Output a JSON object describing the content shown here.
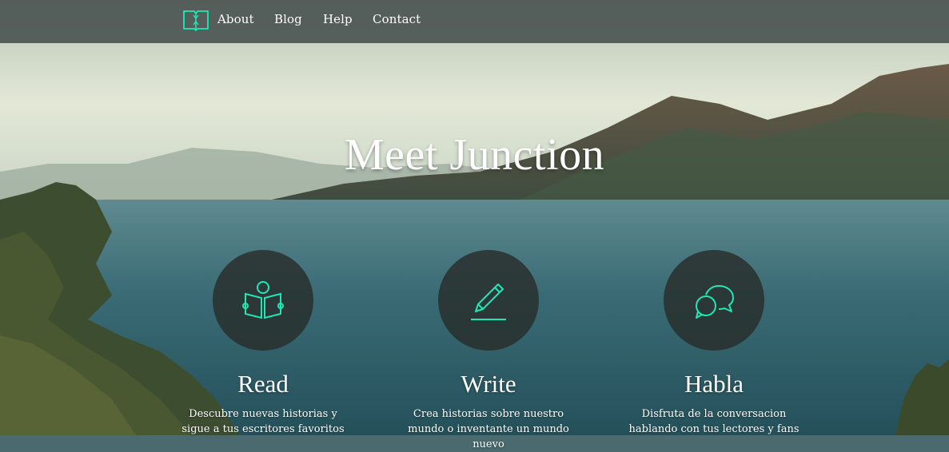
{
  "colors": {
    "accent": "#1de9b6",
    "navbar_bg": "#464e4c",
    "circle_bg": "#282d2b"
  },
  "nav": {
    "logo_icon": "open-book-icon",
    "items": [
      {
        "label": "About"
      },
      {
        "label": "Blog"
      },
      {
        "label": "Help"
      },
      {
        "label": "Contact"
      }
    ]
  },
  "hero": {
    "title": "Meet Junction"
  },
  "features": [
    {
      "icon": "reading-person-icon",
      "title": "Read",
      "description": "Descubre nuevas historias y sigue a tus escritores favoritos"
    },
    {
      "icon": "pencil-icon",
      "title": "Write",
      "description": "Crea historias sobre nuestro mundo o inventante un mundo nuevo"
    },
    {
      "icon": "chat-bubbles-icon",
      "title": "Habla",
      "description": "Disfruta de la conversacion hablando con tus lectores y fans"
    }
  ]
}
